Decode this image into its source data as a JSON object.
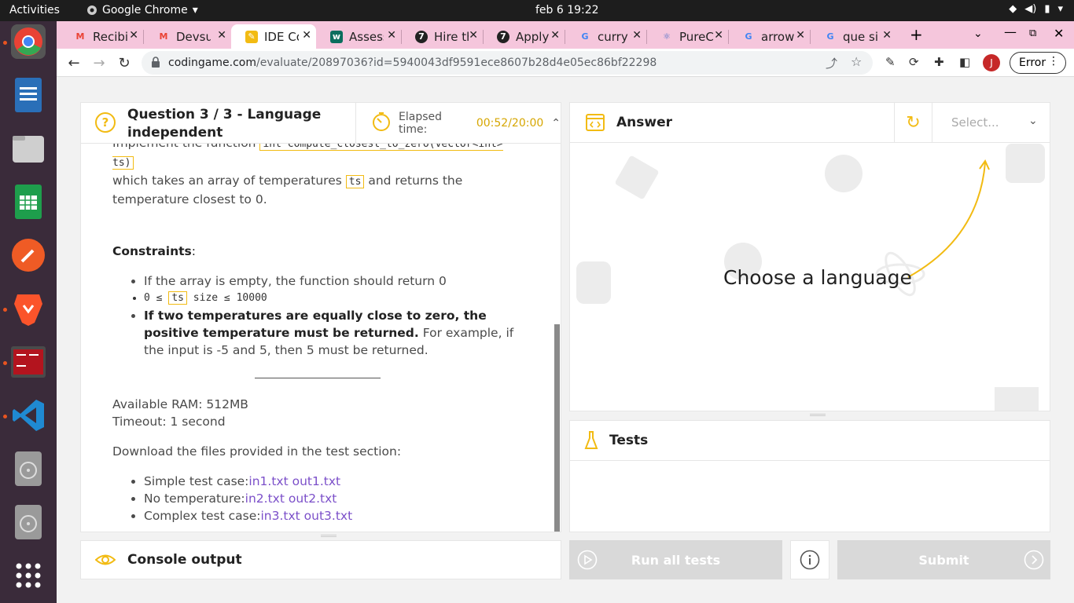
{
  "topbar": {
    "activities": "Activities",
    "app_name": "Google Chrome",
    "clock": "feb 6  19:22"
  },
  "tabs": [
    {
      "label": "Recibi",
      "favicon": "gmail-icon"
    },
    {
      "label": "Devsu",
      "favicon": "gmail-icon"
    },
    {
      "label": "IDE Co",
      "favicon": "codingame-icon",
      "active": true
    },
    {
      "label": "Assess",
      "favicon": "upwork-icon"
    },
    {
      "label": "Hire th",
      "favicon": "toptal-icon"
    },
    {
      "label": "Apply",
      "favicon": "toptal-icon"
    },
    {
      "label": "curry f",
      "favicon": "google-icon"
    },
    {
      "label": "PureC",
      "favicon": "react-icon"
    },
    {
      "label": "arrow",
      "favicon": "google-icon"
    },
    {
      "label": "que si",
      "favicon": "google-icon"
    }
  ],
  "address": {
    "domain": "codingame.com",
    "path": "/evaluate/20897036?id=5940043df9591ece8607b28d4e05ec86bf22298",
    "profile_initial": "J",
    "error_label": "Error"
  },
  "question": {
    "title": "Question 3 / 3 - Language independent",
    "elapsed_label": "Elapsed time:",
    "elapsed_value": "00:52/20:00",
    "intro_clip": "Implement the function",
    "signature": "int compute_closest_to_zero(vector<int> ts)",
    "desc1": "which takes an array of temperatures",
    "ts": "ts",
    "desc2": "and returns the temperature closest to 0.",
    "constraints_label": "Constraints",
    "constraints": {
      "c1": "If the array is empty, the function should return 0",
      "c2_pre": "0 ≤",
      "c2_post": "size ≤ 10000",
      "c3_bold": "If two temperatures are equally close to zero, the positive temperature must be returned.",
      "c3_rest": "For example, if the input is -5 and 5, then 5 must be returned."
    },
    "ram": "Available RAM: 512MB",
    "timeout": "Timeout: 1 second",
    "download": "Download the files provided in the test section:",
    "files": [
      {
        "label": "Simple test case:",
        "in": "in1.txt",
        "out": "out1.txt"
      },
      {
        "label": "No temperature:",
        "in": "in2.txt",
        "out": "out2.txt"
      },
      {
        "label": "Complex test case:",
        "in": "in3.txt",
        "out": "out3.txt"
      }
    ]
  },
  "console": {
    "title": "Console output"
  },
  "answer": {
    "title": "Answer",
    "select_placeholder": "Select...",
    "choose": "Choose a language"
  },
  "tests": {
    "title": "Tests"
  },
  "buttons": {
    "run_all": "Run all tests",
    "submit": "Submit"
  },
  "colors": {
    "accent": "#f2bb13",
    "link": "#7b4fc9",
    "tab_strip": "#f5c6dc"
  }
}
